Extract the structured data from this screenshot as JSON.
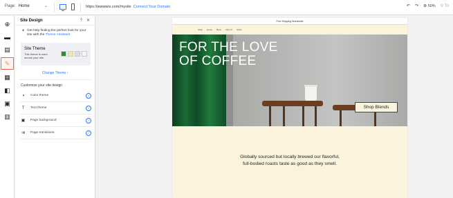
{
  "topbar": {
    "page_label": "Page:",
    "page_value": "Home",
    "url": "https://wwwwix.com/mysite",
    "connect_domain": "Connect Your Domain",
    "zoom": "50%",
    "tools_label": "To"
  },
  "panel": {
    "title": "Site Design",
    "help_text": "Get help finding the perfect look for your site with the",
    "help_link": "Theme Assistant",
    "theme_card": {
      "title": "Site Theme",
      "description": "This theme is used across your site.",
      "swatches": [
        "#2f8a3a",
        "#f7e7a6",
        "#d6dde8",
        "#f8f5ec"
      ]
    },
    "change_theme": "Change Theme",
    "customize_title": "Customize your site design",
    "rows": [
      {
        "label": "Color theme",
        "icon": "palette-icon"
      },
      {
        "label": "Text theme",
        "icon": "text-icon"
      },
      {
        "label": "Page background",
        "icon": "image-icon"
      },
      {
        "label": "Page transitions",
        "icon": "transition-icon"
      }
    ]
  },
  "site": {
    "top_bar": "Free Shipping Worldwide",
    "nav": [
      "Shop",
      "Home",
      "Brew",
      "Visit Us",
      "Order"
    ],
    "hero_title_1": "FOR THE LOVE",
    "hero_title_2": "OF COFFEE",
    "shop_button": "Shop Blends",
    "tagline": "Globally sourced but locally brewed our flavorful, full-bodied roasts taste as good as they smell."
  }
}
